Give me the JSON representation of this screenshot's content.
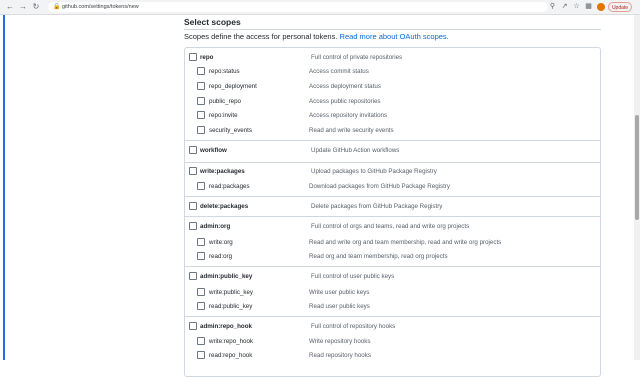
{
  "browser": {
    "url": "github.com/settings/tokens/new",
    "update_label": "Update",
    "icons": [
      "back-icon",
      "forward-icon",
      "reload-icon",
      "lock-icon",
      "search-icon",
      "share-icon",
      "star-icon",
      "extensions-icon",
      "profile-avatar",
      "update-button"
    ]
  },
  "page": {
    "title": "Select scopes",
    "description": "Scopes define the access for personal tokens.",
    "link_text": "Read more about OAuth scopes."
  },
  "scopes": [
    {
      "name": "repo",
      "description": "Full control of private repositories",
      "parent": true
    },
    {
      "name": "repo:status",
      "description": "Access commit status",
      "parent": false
    },
    {
      "name": "repo_deployment",
      "description": "Access deployment status",
      "parent": false
    },
    {
      "name": "public_repo",
      "description": "Access public repositories",
      "parent": false
    },
    {
      "name": "repo:invite",
      "description": "Access repository invitations",
      "parent": false
    },
    {
      "name": "security_events",
      "description": "Read and write security events",
      "parent": false
    },
    {
      "name": "workflow",
      "description": "Update GitHub Action workflows",
      "parent": true
    },
    {
      "name": "write:packages",
      "description": "Upload packages to GitHub Package Registry",
      "parent": true
    },
    {
      "name": "read:packages",
      "description": "Download packages from GitHub Package Registry",
      "parent": false
    },
    {
      "name": "delete:packages",
      "description": "Delete packages from GitHub Package Registry",
      "parent": true
    },
    {
      "name": "admin:org",
      "description": "Full control of orgs and teams, read and write org projects",
      "parent": true
    },
    {
      "name": "write:org",
      "description": "Read and write org and team membership, read and write org projects",
      "parent": false
    },
    {
      "name": "read:org",
      "description": "Read org and team membership, read org projects",
      "parent": false
    },
    {
      "name": "admin:public_key",
      "description": "Full control of user public keys",
      "parent": true
    },
    {
      "name": "write:public_key",
      "description": "Write user public keys",
      "parent": false
    },
    {
      "name": "read:public_key",
      "description": "Read user public keys",
      "parent": false
    },
    {
      "name": "admin:repo_hook",
      "description": "Full control of repository hooks",
      "parent": true
    },
    {
      "name": "write:repo_hook",
      "description": "Write repository hooks",
      "parent": false
    },
    {
      "name": "read:repo_hook",
      "description": "Read repository hooks",
      "parent": false
    }
  ]
}
